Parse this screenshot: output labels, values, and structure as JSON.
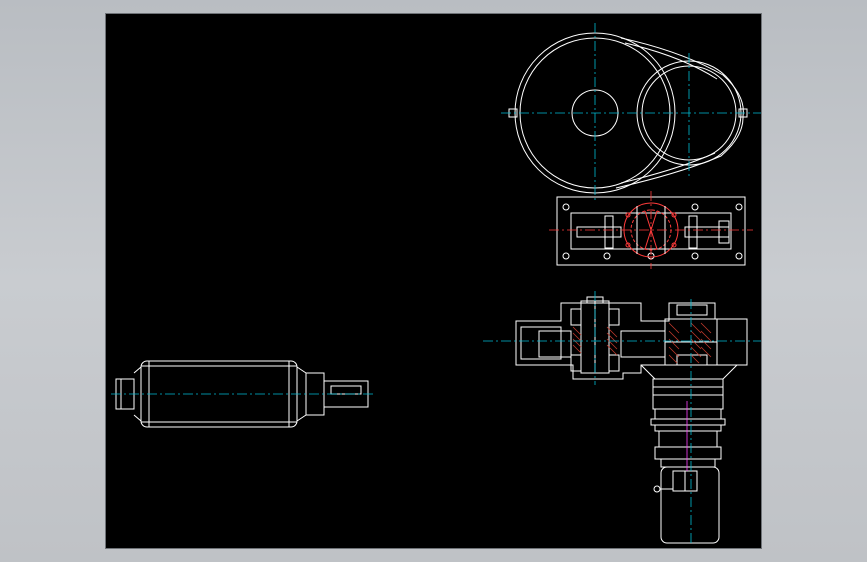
{
  "viewport": {
    "background": "#000000",
    "frame_color": "#c4c7cb"
  },
  "colors": {
    "outline": "#ffffff",
    "centerline": "#00bcd4",
    "section_red": "#ff3b3b",
    "hatch": "#c0392b",
    "accent_magenta": "#ff40ff"
  },
  "drawing": {
    "views": [
      {
        "name": "roller-side-view"
      },
      {
        "name": "belt-drive-front-view"
      },
      {
        "name": "gearbox-top-section"
      },
      {
        "name": "gearbox-sectional-view"
      },
      {
        "name": "motor-assembly-view"
      }
    ]
  }
}
